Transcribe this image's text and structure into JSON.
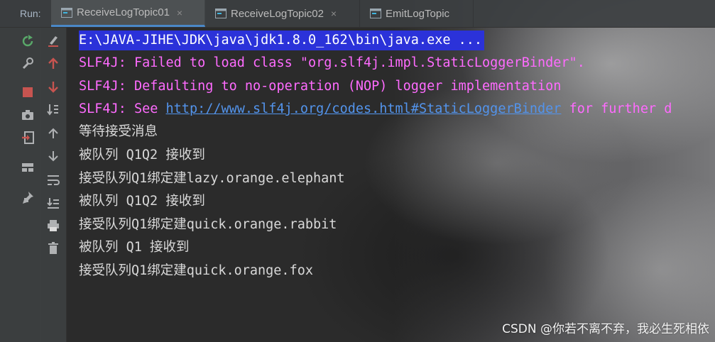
{
  "run_label": "Run:",
  "tabs": [
    {
      "label": "ReceiveLogTopic01",
      "active": true,
      "close": "×"
    },
    {
      "label": "ReceiveLogTopic02",
      "active": false,
      "close": "×"
    },
    {
      "label": "EmitLogTopic",
      "active": false,
      "close": ""
    }
  ],
  "console": {
    "command": "E:\\JAVA-JIHE\\JDK\\java\\jdk1.8.0_162\\bin\\java.exe ...",
    "slf4j_1": "SLF4J: Failed to load class \"org.slf4j.impl.StaticLoggerBinder\".",
    "slf4j_2": "SLF4J: Defaulting to no-operation (NOP) logger implementation",
    "slf4j_3_prefix": "SLF4J: See ",
    "slf4j_3_link": "http://www.slf4j.org/codes.html#StaticLoggerBinder",
    "slf4j_3_suffix": " for further d",
    "lines": [
      "等待接受消息",
      "被队列 Q1Q2 接收到",
      "接受队列Q1绑定建lazy.orange.elephant",
      "被队列 Q1Q2 接收到",
      "接受队列Q1绑定建quick.orange.rabbit",
      "被队列 Q1 接收到",
      "接受队列Q1绑定建quick.orange.fox"
    ]
  },
  "watermark": "CSDN @你若不离不弃，我必生死相依",
  "colors": {
    "command_bg": "#2b32d9",
    "error_text": "#ff6bff",
    "link": "#5394ec",
    "tab_underline": "#4a88c7"
  },
  "icons": {
    "col1": [
      "rerun-icon",
      "wrench-icon",
      "stop-icon",
      "camera-icon",
      "exit-icon",
      "layout-icon",
      "pin-icon"
    ],
    "col2": [
      "clear-icon",
      "up-arrow-icon",
      "down-arrow-icon",
      "sort-icon",
      "scroll-up-icon",
      "scroll-down-icon",
      "soft-wrap-icon",
      "scroll-to-end-icon",
      "print-icon",
      "trash-icon"
    ]
  }
}
